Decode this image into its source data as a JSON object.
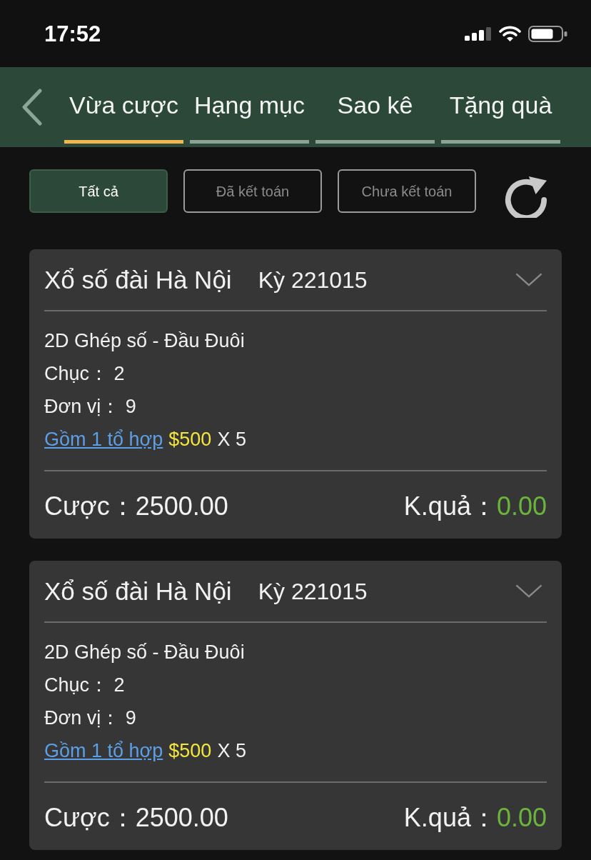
{
  "status_bar": {
    "time": "17:52"
  },
  "tabs": [
    {
      "label": "Vừa cược",
      "selected": true
    },
    {
      "label": "Hạng mục",
      "selected": false
    },
    {
      "label": "Sao kê",
      "selected": false
    },
    {
      "label": "Tặng quà",
      "selected": false
    }
  ],
  "filters": [
    {
      "label": "Tất cả",
      "selected": true
    },
    {
      "label": "Đã kết toán",
      "selected": false
    },
    {
      "label": "Chưa kết toán",
      "selected": false
    }
  ],
  "bets": [
    {
      "title": "Xổ số đài Hà Nội",
      "period": "Kỳ 221015",
      "game": "2D Ghép số - Đầu Đuôi",
      "picks": [
        "Chục： 2",
        "Đơn vị： 9"
      ],
      "combo_link": "Gồm 1 tổ hợp",
      "unit_amount": "$500",
      "multiplier": "X 5",
      "stake": "Cược：2500.00",
      "result_label": "K.quả：",
      "result_value": "0.00"
    },
    {
      "title": "Xổ số đài Hà Nội",
      "period": "Kỳ 221015",
      "game": "2D Ghép số - Đầu Đuôi",
      "picks": [
        "Chục： 2",
        "Đơn vị： 9"
      ],
      "combo_link": "Gồm 1 tổ hợp",
      "unit_amount": "$500",
      "multiplier": "X 5",
      "stake": "Cược：2500.00",
      "result_label": "K.quả：",
      "result_value": "0.00"
    }
  ]
}
